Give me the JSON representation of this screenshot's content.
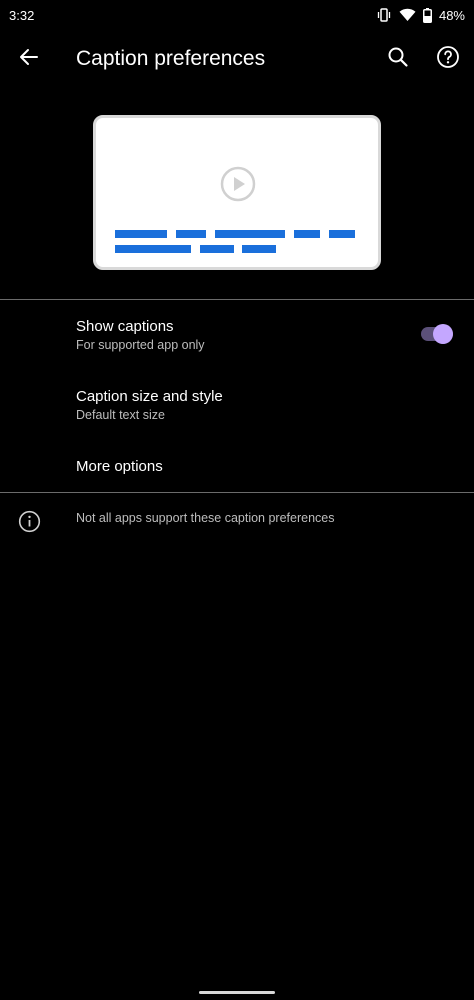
{
  "status_bar": {
    "time": "3:32",
    "battery_percent": "48%",
    "icons": [
      "vibrate-icon",
      "wifi-icon",
      "battery-icon"
    ]
  },
  "app_bar": {
    "title": "Caption preferences",
    "icons": [
      "back-arrow-icon",
      "search-icon",
      "help-icon"
    ]
  },
  "preview": {
    "icon": "play-circle-icon",
    "caption_color": "#1a6fdb"
  },
  "settings": {
    "show_captions": {
      "title": "Show captions",
      "subtitle": "For supported app only",
      "enabled": true
    },
    "caption_size": {
      "title": "Caption size and style",
      "subtitle": "Default text size"
    },
    "more_options": {
      "title": "More options"
    }
  },
  "footer": {
    "icon": "info-icon",
    "text": "Not all apps support these caption preferences"
  },
  "colors": {
    "background": "#000000",
    "accent": "#c4a7ff",
    "toggle_track": "#5b5079"
  }
}
